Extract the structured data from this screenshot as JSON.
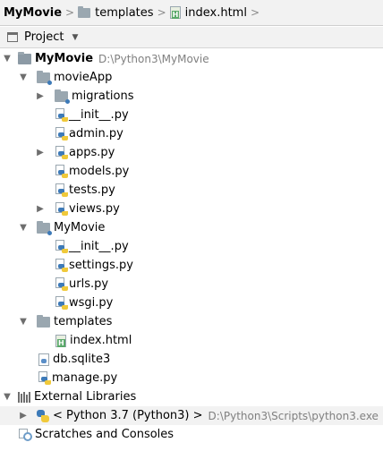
{
  "breadcrumb": {
    "root": "MyMovie",
    "folder": "templates",
    "file": "index.html"
  },
  "toolbar": {
    "view_label": "Project"
  },
  "tree": {
    "root": {
      "name": "MyMovie",
      "path": "D:\\Python3\\MyMovie"
    },
    "movieApp": "movieApp",
    "migrations": "migrations",
    "movieApp_init": "__init__.py",
    "admin": "admin.py",
    "apps": "apps.py",
    "models": "models.py",
    "tests": "tests.py",
    "views": "views.py",
    "mymovie_pkg": "MyMovie",
    "mymovie_init": "__init__.py",
    "settings": "settings.py",
    "urls": "urls.py",
    "wsgi": "wsgi.py",
    "templates": "templates",
    "index_html": "index.html",
    "db": "db.sqlite3",
    "manage": "manage.py",
    "external_libraries": "External Libraries",
    "python_sdk": {
      "name": "< Python 3.7 (Python3) >",
      "path": "D:\\Python3\\Scripts\\python3.exe"
    },
    "scratches": "Scratches and Consoles"
  }
}
